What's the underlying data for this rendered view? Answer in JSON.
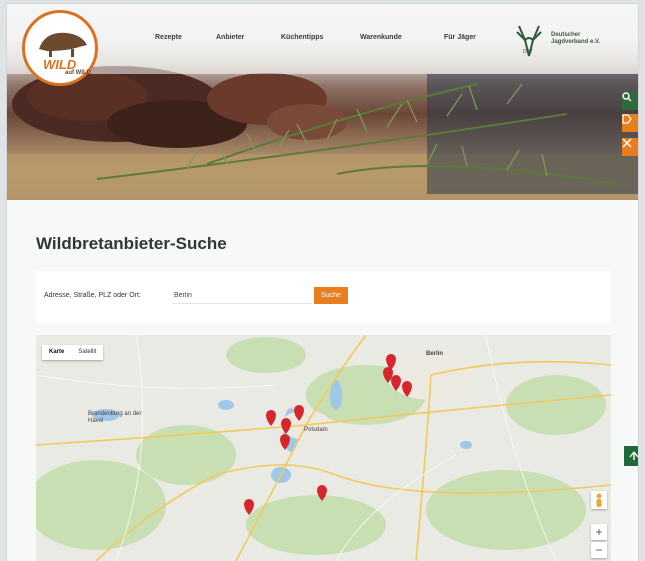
{
  "brand": {
    "logo_text": "WILD",
    "logo_sub": "auf WILD"
  },
  "nav": {
    "items": [
      "Rezepte",
      "Anbieter",
      "Küchentipps",
      "Warenkunde",
      "Für Jäger"
    ]
  },
  "partner": {
    "name_line1": "Deutscher",
    "name_line2": "Jagdverband e.V.",
    "badge": "DJV"
  },
  "side_tools": [
    "search-icon",
    "tag-icon",
    "tools-icon"
  ],
  "page": {
    "title": "Wildbretanbieter-Suche"
  },
  "search": {
    "label": "Adresse, Straße, PLZ oder Ort:",
    "value": "Berlin",
    "button": "Suche"
  },
  "map": {
    "tabs": [
      "Karte",
      "Satellit"
    ],
    "active_tab": "Karte",
    "places": [
      "Berlin",
      "Potsdam",
      "Brandenburg an der Havel"
    ],
    "zoom_in": "+",
    "zoom_out": "−",
    "marker_color": "#d6262b"
  },
  "colors": {
    "accent": "#e87f1e",
    "title": "#2f3a2f",
    "back_to_top": "#1f6a3a"
  }
}
